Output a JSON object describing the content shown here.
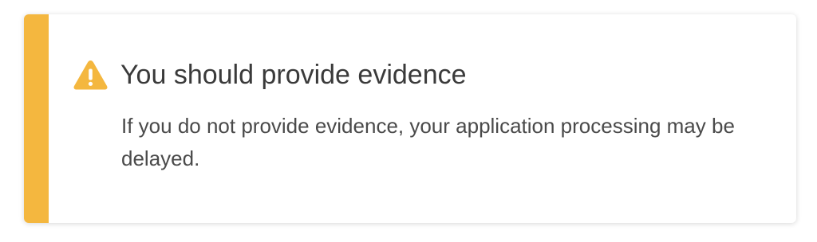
{
  "alert": {
    "title": "You should provide evidence",
    "message": "If you do not provide evidence, your application processing may be delayed.",
    "icon": "warning-icon",
    "colors": {
      "accent": "#F4B73F",
      "icon": "#F4B73F",
      "title_text": "#3A3A3A",
      "body_text": "#4A4A4A"
    }
  }
}
